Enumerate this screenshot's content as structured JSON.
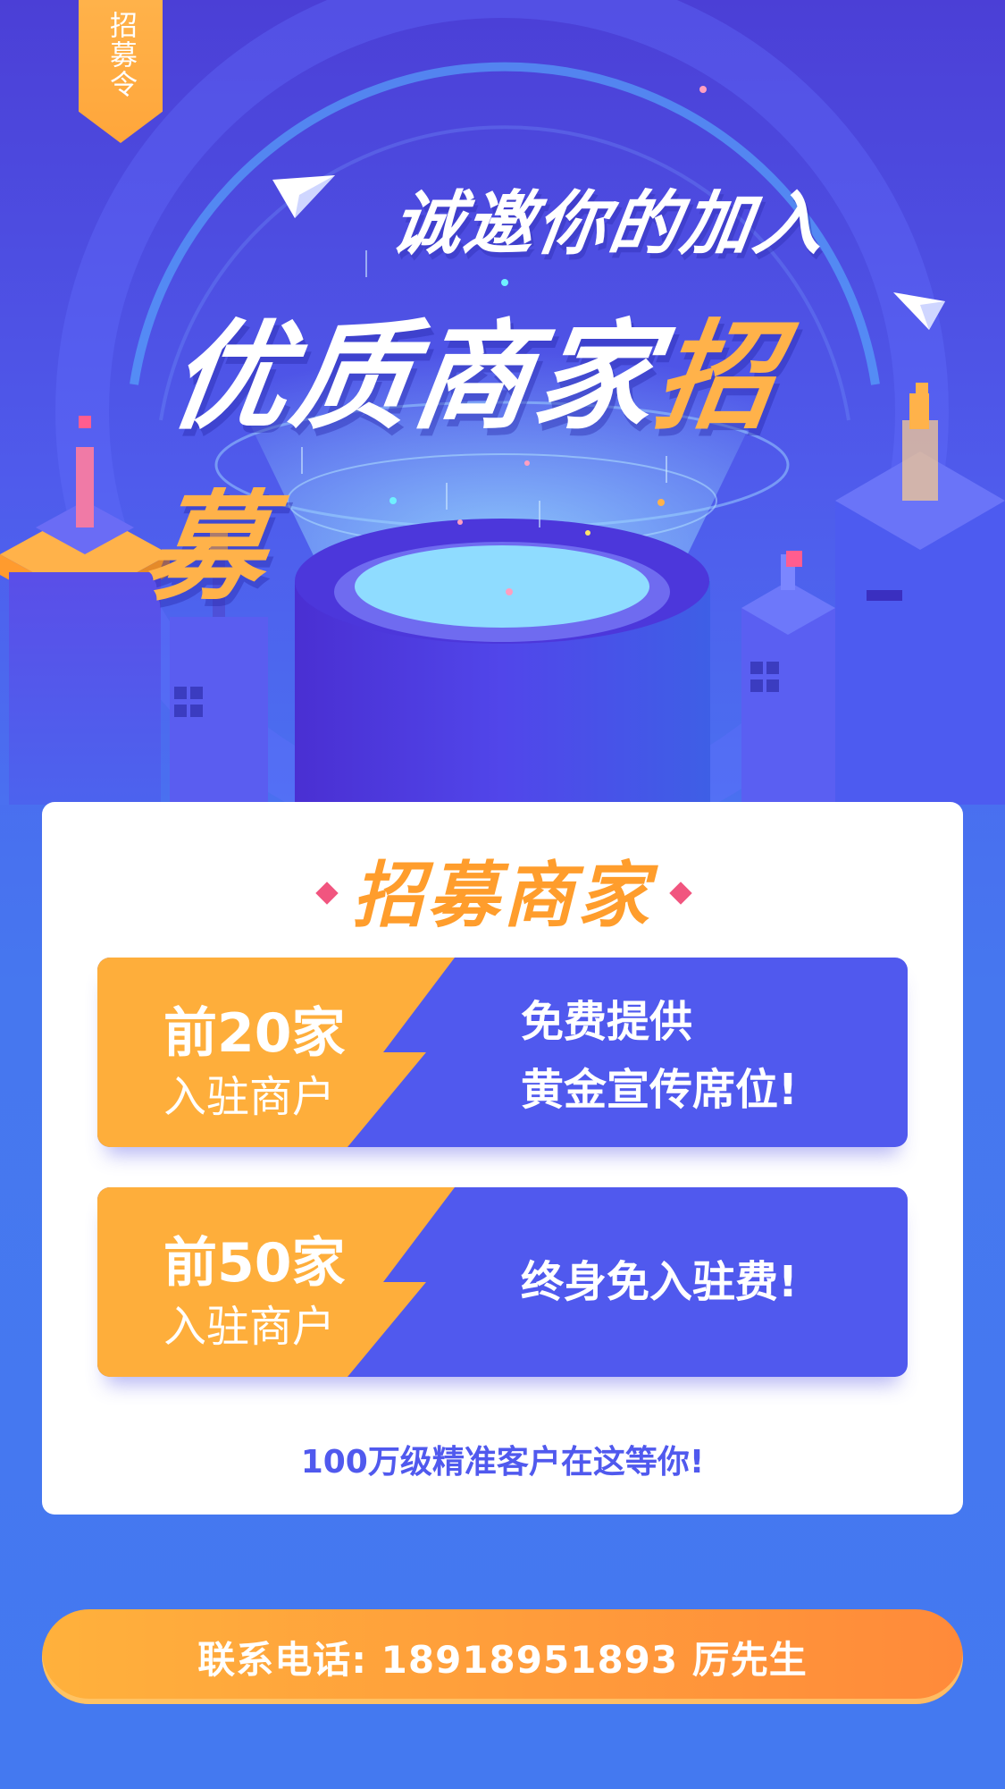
{
  "ribbon": {
    "text": "招募令"
  },
  "headline": {
    "invite": "诚邀你的加入",
    "main_white": "优质商家",
    "main_accent": "招募"
  },
  "card": {
    "title": "招募商家",
    "offers": [
      {
        "count": "前20家",
        "who": "入驻商户",
        "line1": "免费提供",
        "line2": "黄金宣传席位!"
      },
      {
        "count": "前50家",
        "who": "入驻商户",
        "line1": "终身免入驻费!"
      }
    ],
    "footer": "100万级精准客户在这等你!"
  },
  "contact": {
    "text": "联系电话: 18918951893 厉先生"
  },
  "colors": {
    "background": "#4a5ff0",
    "accent_orange": "#feae3b",
    "accent_blue": "#5059ee",
    "highlight_pink": "#f1557f"
  },
  "icons": [
    "paper-plane-icon",
    "diamond-icon"
  ]
}
